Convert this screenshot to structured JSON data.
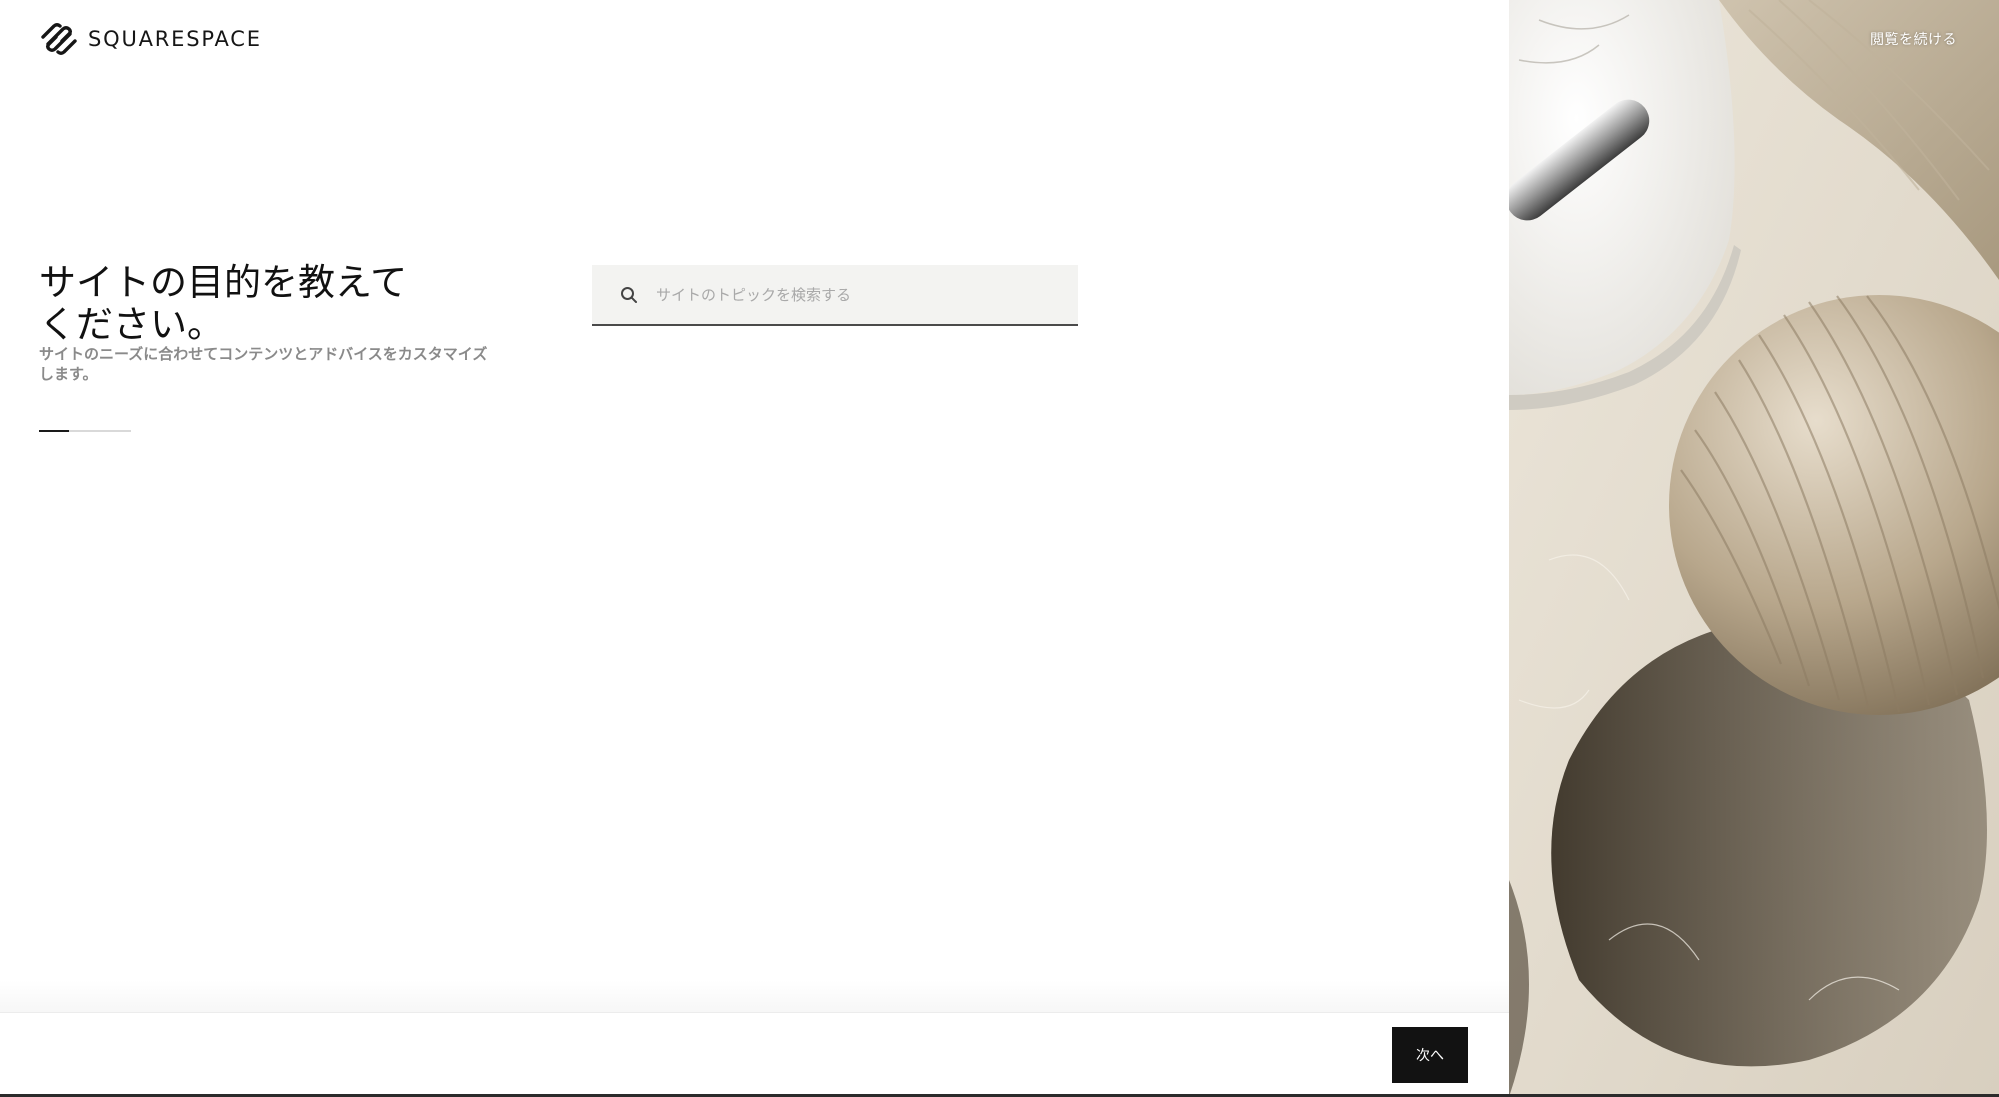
{
  "brand": {
    "name": "SQUARESPACE"
  },
  "header": {
    "continue_link": "閲覧を続ける"
  },
  "main": {
    "title_line1": "サイトの目的を教えて",
    "title_line2": "ください。",
    "subtitle_line1": "サイトのニーズに合わせてコンテンツとアドバイスをカスタマイズ",
    "subtitle_line2": "します。",
    "progress": 0.33
  },
  "search": {
    "placeholder": "サイトのトピックを検索する",
    "value": ""
  },
  "footer": {
    "next_label": "次へ"
  },
  "icons": {
    "logo": "squarespace-logo-icon",
    "search": "search-icon"
  },
  "colors": {
    "primary_button": "#121212",
    "search_background": "#f3f3f1",
    "text_dark": "#111111",
    "text_muted": "#8a8a8a"
  }
}
